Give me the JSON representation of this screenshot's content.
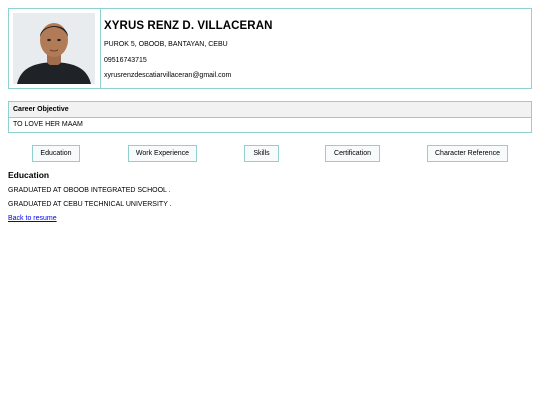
{
  "profile": {
    "name": "XYRUS RENZ D. VILLACERAN",
    "address": "PUROK 5, OBOOB, BANTAYAN, CEBU",
    "phone": "09516743715",
    "email": "xyrusrenzdescatiarvillaceran@gmail.com"
  },
  "objective": {
    "heading": "Career Objective",
    "text": "TO LOVE HER MAAM"
  },
  "tabs": [
    {
      "label": "Education"
    },
    {
      "label": "Work Experience"
    },
    {
      "label": "Skills"
    },
    {
      "label": "Certification"
    },
    {
      "label": "Character Reference"
    }
  ],
  "section": {
    "title": "Education",
    "items": [
      "GRADUATED AT OBOOB INTEGRATED SCHOOL .",
      "GRADUATED AT CEBU TECHNICAL UNIVERSITY ."
    ]
  },
  "back_link": "Back to resume",
  "colors": {
    "border": "#8fd1d1",
    "header_bg": "#f2f2f2",
    "link": "#0000ee"
  }
}
